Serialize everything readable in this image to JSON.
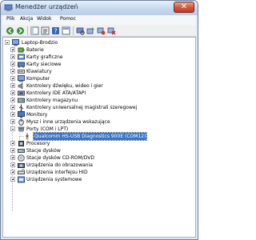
{
  "window": {
    "title": "Menedżer urządzeń",
    "close_label": "✕"
  },
  "menu": [
    "Plik",
    "Akcja",
    "Widok",
    "Pomoc"
  ],
  "toolbar": [
    "back-icon",
    "forward-icon",
    "show-hide-tree-icon",
    "properties-icon",
    "help-icon",
    "view-icon",
    "scan-hardware-icon",
    "update-driver-icon",
    "disable-device-icon",
    "uninstall-device-icon"
  ],
  "tree": {
    "root": "Laptop-Brodzio",
    "categories": [
      {
        "label": "Baterie",
        "icon": "battery-icon"
      },
      {
        "label": "Karty graficzne",
        "icon": "display-adapter-icon"
      },
      {
        "label": "Karty sieciowe",
        "icon": "network-adapter-icon"
      },
      {
        "label": "Klawiatury",
        "icon": "keyboard-icon"
      },
      {
        "label": "Komputer",
        "icon": "computer-icon"
      },
      {
        "label": "Kontrolery dźwięku, wideo i gier",
        "icon": "sound-icon"
      },
      {
        "label": "Kontrolery IDE ATA/ATAPI",
        "icon": "ide-controller-icon"
      },
      {
        "label": "Kontrolery magazynu",
        "icon": "storage-controller-icon"
      },
      {
        "label": "Kontrolery uniwersalnej magistrali szeregowej",
        "icon": "usb-controller-icon"
      },
      {
        "label": "Monitory",
        "icon": "monitor-icon"
      },
      {
        "label": "Mysz i inne urządzenia wskazujące",
        "icon": "mouse-icon"
      },
      {
        "label": "Porty (COM i LPT)",
        "icon": "port-icon",
        "expanded": true
      },
      {
        "label": "Procesory",
        "icon": "processor-icon"
      },
      {
        "label": "Stacje dysków",
        "icon": "disk-drive-icon"
      },
      {
        "label": "Stacje dysków CD-ROM/DVD",
        "icon": "cdrom-icon"
      },
      {
        "label": "Urządzenia do obrazowania",
        "icon": "imaging-icon"
      },
      {
        "label": "Urządzenia interfejsu HID",
        "icon": "hid-icon"
      },
      {
        "label": "Urządzenia systemowe",
        "icon": "system-device-icon"
      }
    ],
    "port_child": {
      "label": "Qualcomm HS-USB Diagnostics 900E (COM12)",
      "icon": "com-port-icon"
    }
  }
}
